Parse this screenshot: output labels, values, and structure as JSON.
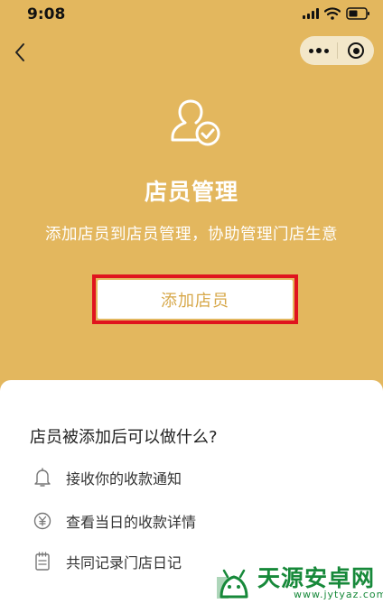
{
  "status_bar": {
    "time": "9:08"
  },
  "nav": {
    "back_icon": "chevron-left-icon",
    "more_icon": "more-dots-icon",
    "close_icon": "circle-close-icon",
    "capsule_color": "#F3E7C9"
  },
  "hero": {
    "icon": "user-check-icon",
    "title": "店员管理",
    "subtitle": "添加店员到店员管理，协助管理门店生意",
    "add_button_label": "添加店员",
    "background_color": "#E3B75E",
    "highlight_color": "#E0141E"
  },
  "info": {
    "question": "店员被添加后可以做什么?",
    "features": [
      {
        "icon": "bell-icon",
        "label": "接收你的收款通知"
      },
      {
        "icon": "yuan-icon",
        "label": "查看当日的收款详情"
      },
      {
        "icon": "notepad-icon",
        "label": "共同记录门店日记"
      }
    ]
  },
  "watermark": {
    "name": "天源安卓网",
    "url": "www.jytyaz.com",
    "color": "#17893A"
  }
}
